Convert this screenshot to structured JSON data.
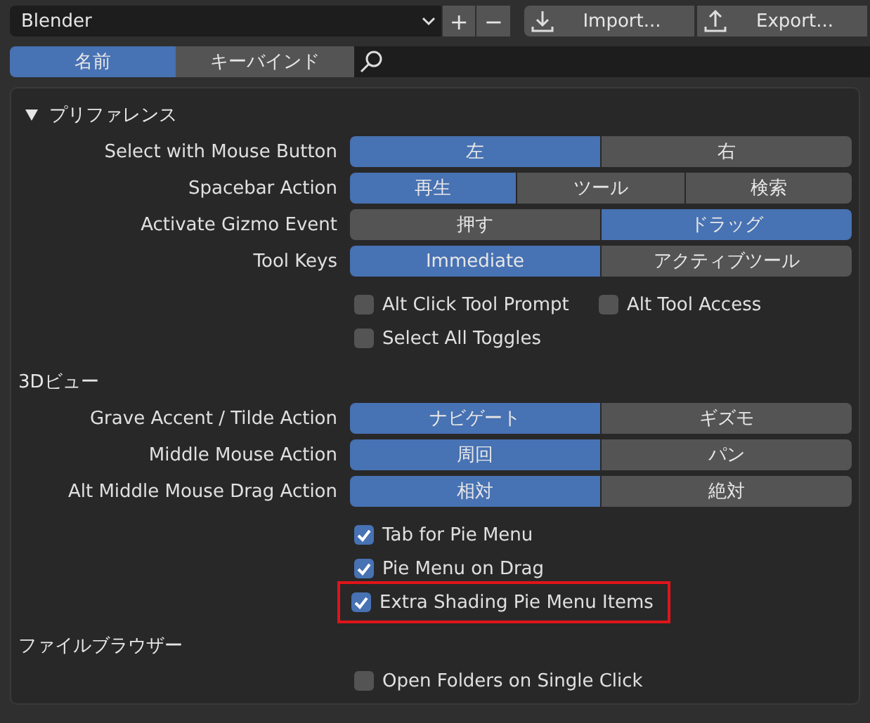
{
  "preset": {
    "value": "Blender"
  },
  "preset_buttons": [
    "+",
    "−"
  ],
  "io_buttons": [
    {
      "kind": "import",
      "label": "Import..."
    },
    {
      "kind": "export",
      "label": "Export..."
    }
  ],
  "tabs": [
    {
      "label": "名前",
      "selected": true
    },
    {
      "label": "キーバインド",
      "selected": false
    }
  ],
  "sections": [
    {
      "title": "プリファレンス",
      "expanded": true,
      "rows": [
        {
          "label": "Select with Mouse Button",
          "options": [
            {
              "label": "左",
              "selected": true
            },
            {
              "label": "右",
              "selected": false
            }
          ]
        },
        {
          "label": "Spacebar Action",
          "options": [
            {
              "label": "再生",
              "selected": true
            },
            {
              "label": "ツール",
              "selected": false
            },
            {
              "label": "検索",
              "selected": false
            }
          ]
        },
        {
          "label": "Activate Gizmo Event",
          "options": [
            {
              "label": "押す",
              "selected": false
            },
            {
              "label": "ドラッグ",
              "selected": true
            }
          ]
        },
        {
          "label": "Tool Keys",
          "options": [
            {
              "label": "Immediate",
              "selected": true
            },
            {
              "label": "アクティブツール",
              "selected": false
            }
          ]
        }
      ],
      "checkbox_rows": [
        [
          {
            "label": "Alt Click Tool Prompt",
            "checked": false,
            "highlighted": false
          },
          {
            "label": "Alt Tool Access",
            "checked": false,
            "highlighted": false
          }
        ],
        [
          {
            "label": "Select All Toggles",
            "checked": false,
            "highlighted": false
          }
        ]
      ]
    },
    {
      "title": "3Dビュー",
      "rows": [
        {
          "label": "Grave Accent / Tilde Action",
          "options": [
            {
              "label": "ナビゲート",
              "selected": true
            },
            {
              "label": "ギズモ",
              "selected": false
            }
          ]
        },
        {
          "label": "Middle Mouse Action",
          "options": [
            {
              "label": "周回",
              "selected": true
            },
            {
              "label": "パン",
              "selected": false
            }
          ]
        },
        {
          "label": "Alt Middle Mouse Drag Action",
          "options": [
            {
              "label": "相対",
              "selected": true
            },
            {
              "label": "絶対",
              "selected": false
            }
          ]
        }
      ],
      "checkbox_rows": [
        [
          {
            "label": "Tab for Pie Menu",
            "checked": true,
            "highlighted": false
          }
        ],
        [
          {
            "label": "Pie Menu on Drag",
            "checked": true,
            "highlighted": false
          }
        ],
        [
          {
            "label": "Extra Shading Pie Menu Items",
            "checked": true,
            "highlighted": true
          }
        ]
      ]
    },
    {
      "title": "ファイルブラウザー",
      "checkbox_rows": [
        [
          {
            "label": "Open Folders on Single Click",
            "checked": false,
            "highlighted": false
          }
        ]
      ]
    }
  ]
}
